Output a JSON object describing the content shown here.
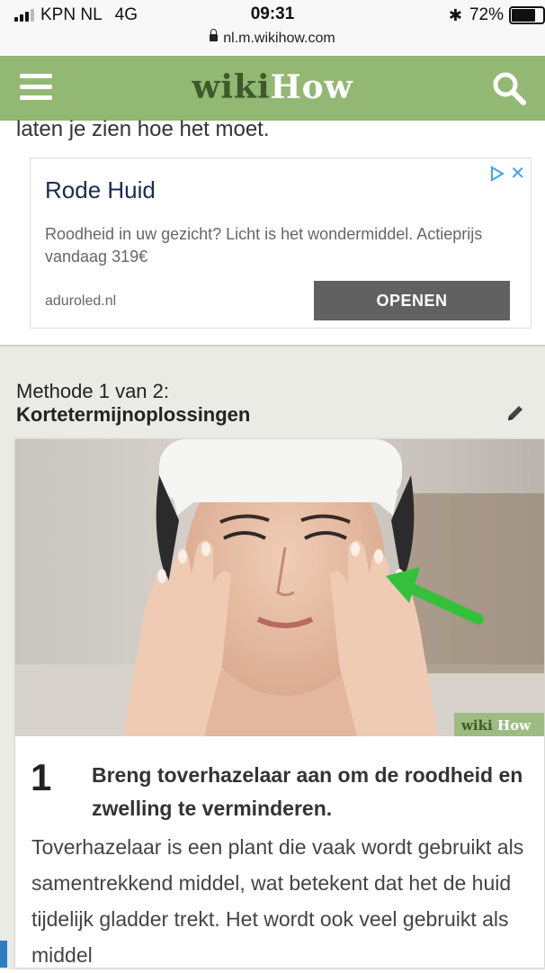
{
  "status_bar": {
    "carrier": "KPN NL",
    "network": "4G",
    "time": "09:31",
    "battery_text": "72%",
    "battery_level": 0.72,
    "url": "nl.m.wikihow.com"
  },
  "header": {
    "logo_part1": "wiki",
    "logo_part2": "How",
    "accent_color": "#93b874"
  },
  "intro_text": "laten je zien hoe het moet.",
  "ad": {
    "title": "Rode Huid",
    "description": "Roodheid in uw gezicht? Licht is het wondermiddel. Actieprijs vandaag 319€",
    "domain": "aduroled.nl",
    "cta": "OPENEN"
  },
  "method": {
    "label": "Methode 1 van 2:",
    "title": "Kortetermijnoplossingen"
  },
  "step": {
    "image_watermark_1": "wiki",
    "image_watermark_2": "How",
    "number": "1",
    "title": "Breng toverhazelaar aan om de roodheid en zwelling te verminderen.",
    "body": "Toverhazelaar is een plant die vaak wordt gebruikt als samentrekkend middel, wat betekent dat het de huid tijdelijk gladder trekt. Het wordt ook veel gebruikt als middel"
  }
}
